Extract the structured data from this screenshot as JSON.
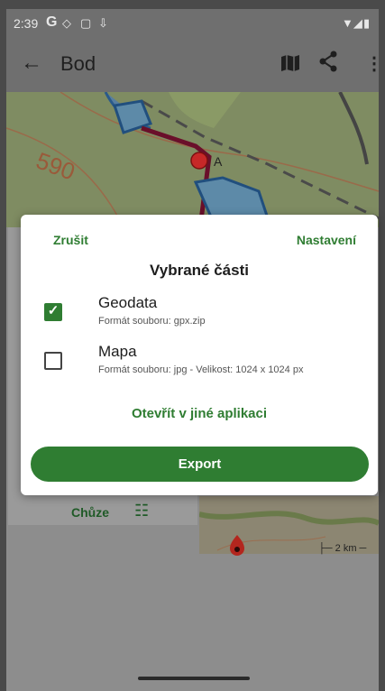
{
  "status": {
    "time": "2:39",
    "google": "G"
  },
  "appbar": {
    "title": "Bod"
  },
  "map": {
    "point_label": "A",
    "contour_label": "590"
  },
  "under": {
    "activity": "Chůze",
    "scale": "2 km"
  },
  "dialog": {
    "cancel": "Zrušit",
    "settings": "Nastavení",
    "title": "Vybrané části",
    "options": [
      {
        "label": "Geodata",
        "sub": "Formát souboru: gpx.zip",
        "checked": true
      },
      {
        "label": "Mapa",
        "sub": "Formát souboru: jpg - Velikost: 1024 x 1024 px",
        "checked": false
      }
    ],
    "open_other": "Otevřít v jiné aplikaci",
    "export": "Export"
  },
  "colors": {
    "accent": "#2f7d32",
    "route": "#7a1030"
  },
  "icons": [
    "back-arrow-icon",
    "map-icon",
    "share-icon",
    "more-vert-icon",
    "checkbox-checked-icon",
    "checkbox-empty-icon",
    "tune-icon",
    "location-pin-icon"
  ]
}
